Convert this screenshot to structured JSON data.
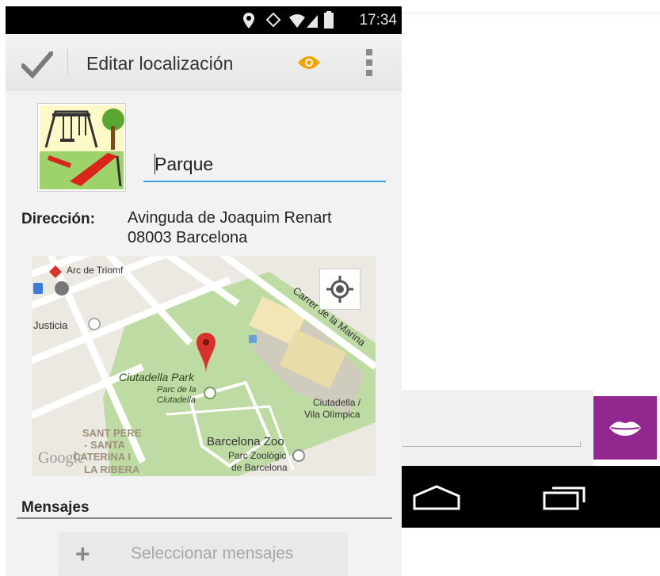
{
  "status_bar": {
    "time": "17:34"
  },
  "action_bar": {
    "title": "Editar localización"
  },
  "location": {
    "name_value": "Parque",
    "address_label": "Dirección:",
    "address_line1": "Avinguda de Joaquim Renart",
    "address_line2": "08003 Barcelona"
  },
  "map": {
    "labels": {
      "arc": "Arc de Triomf",
      "justicia": "Justicia",
      "carrer": "Carrer de la Marina",
      "park": "Ciutadella Park",
      "parc1": "Parc de la",
      "parc2": "Ciutadella",
      "ciut1": "Ciutadella /",
      "ciut2": "Vila Olímpica",
      "santpere1": "SANT PERE",
      "santpere2": "- SANTA",
      "santpere3": "CATERINA I",
      "santpere4": "LA RIBERA",
      "zoo": "Barcelona Zoo",
      "zoo2": "Parc Zoològic",
      "zoo3": "de Barcelona",
      "google": "Google"
    }
  },
  "messages": {
    "label": "Mensajes",
    "select_button": "Seleccionar mensajes"
  },
  "icons": [
    "check-icon",
    "eye-icon",
    "overflow-menu-icon",
    "location-pin-icon",
    "wifi-icon",
    "signal-icon",
    "battery-icon",
    "playground-icon",
    "map-marker-icon",
    "my-location-icon",
    "plus-icon",
    "lips-icon",
    "home-icon",
    "recents-icon"
  ],
  "colors": {
    "accent": "#33a4e0",
    "eye": "#f0a400",
    "lips_button": "#92278f",
    "marker": "#d9322b"
  }
}
